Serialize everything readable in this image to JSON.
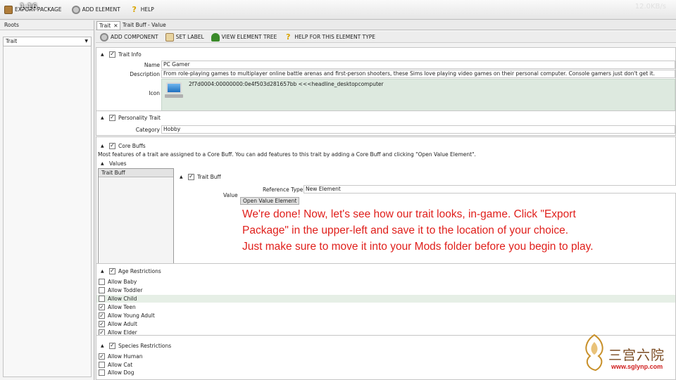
{
  "overlay_timestamp": "1:16",
  "system_info": "12.0KB/s",
  "toolbar": {
    "export_label": "EXPORT PACKAGE",
    "add_element_label": "ADD ELEMENT",
    "help_label": "HELP"
  },
  "left_panel": {
    "roots_label": "Roots",
    "selected": "Trait"
  },
  "tabs": [
    {
      "label": "Trait",
      "close": "✕"
    }
  ],
  "tab_path": "Trait Buff - Value",
  "element_toolbar": {
    "add_component": "ADD COMPONENT",
    "set_label": "SET LABEL",
    "view_tree": "VIEW ELEMENT TREE",
    "help_type": "HELP FOR THIS ELEMENT TYPE"
  },
  "trait_info": {
    "title": "Trait Info",
    "name_label": "Name",
    "name_value": "PC Gamer",
    "description_label": "Description",
    "description_value": "From role-playing games to multiplayer online battle arenas and first-person shooters, these Sims love playing video games on their personal computer. Console gamers just don't get it.",
    "icon_label": "Icon",
    "icon_key": "2f7d0004:00000000:0e4f503d281657bb <<<headline_desktopcomputer"
  },
  "personality": {
    "title": "Personality Trait",
    "category_label": "Category",
    "category_value": "Hobby"
  },
  "core_buffs": {
    "title": "Core Buffs",
    "description": "Most features of a trait are assigned to a Core Buff. You can add features to this trait by adding a Core Buff and clicking \"Open Value Element\".",
    "values_label": "Values",
    "list_item": "Trait Buff",
    "buff_title": "Trait Buff",
    "value_label": "Value",
    "reference_type_label": "Reference Type",
    "reference_type_value": "New Element",
    "open_button": "Open Value Element"
  },
  "overlay_text": {
    "line1": "We're done! Now, let's see how our trait looks, in-game. Click \"Export",
    "line2": "Package\" in the upper-left and save it to the location of your choice.",
    "line3": "Just make sure to move it into your Mods folder before you begin to play."
  },
  "age_restrictions": {
    "title": "Age Restrictions",
    "items": [
      {
        "label": "Allow Baby",
        "checked": false
      },
      {
        "label": "Allow Toddler",
        "checked": false
      },
      {
        "label": "Allow Child",
        "checked": false
      },
      {
        "label": "Allow Teen",
        "checked": true
      },
      {
        "label": "Allow Young Adult",
        "checked": true
      },
      {
        "label": "Allow Adult",
        "checked": true
      },
      {
        "label": "Allow Elder",
        "checked": true
      }
    ]
  },
  "species_restrictions": {
    "title": "Species Restrictions",
    "items": [
      {
        "label": "Allow Human",
        "checked": true
      },
      {
        "label": "Allow Cat",
        "checked": false
      },
      {
        "label": "Allow Dog",
        "checked": false
      }
    ]
  },
  "watermark": {
    "text": "三宫六院",
    "url": "www.sglynp.com"
  },
  "check_glyph": "✓"
}
